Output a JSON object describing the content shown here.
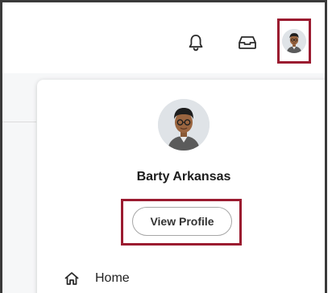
{
  "header": {
    "icons": {
      "notifications": "bell-icon",
      "inbox": "inbox-icon",
      "profile": "avatar"
    }
  },
  "profile_menu": {
    "user_name": "Barty Arkansas",
    "view_profile_label": "View Profile",
    "items": [
      {
        "label": "Home",
        "icon": "home-icon"
      }
    ]
  },
  "colors": {
    "highlight": "#9b1b30",
    "frame": "#3a3a3a",
    "background": "#f6f7f8"
  }
}
